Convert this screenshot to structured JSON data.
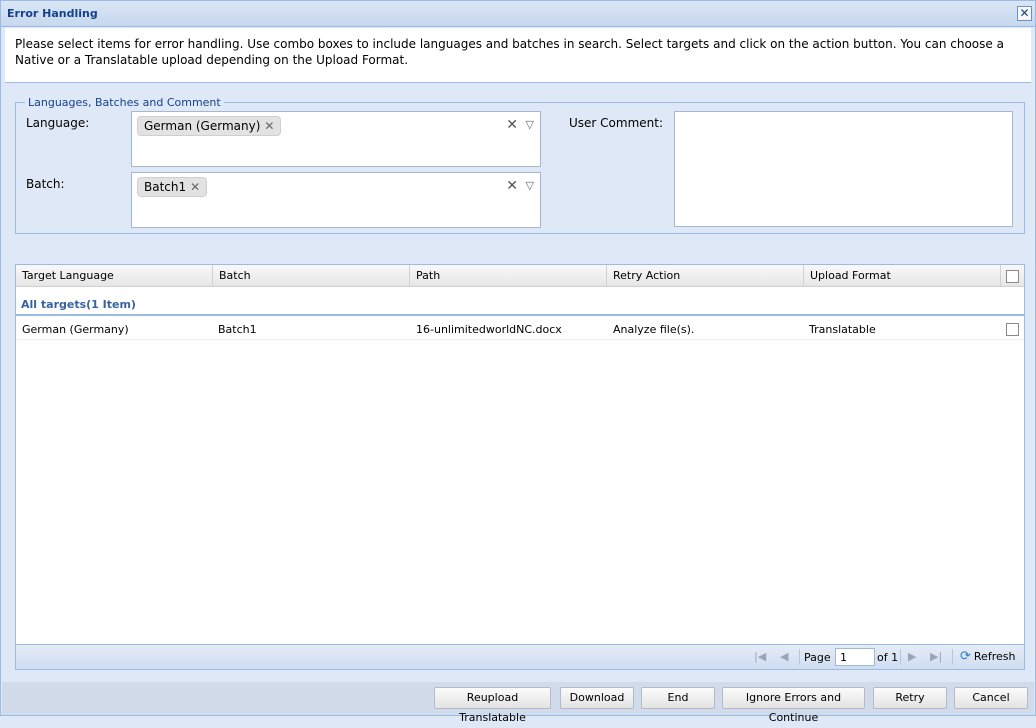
{
  "window": {
    "title": "Error Handling",
    "close_glyph": "✕"
  },
  "instructions": "Please select items for error handling. Use combo boxes to include languages and batches in search. Select targets and click on the action button. You can choose a Native or a Translatable upload depending on the Upload Format.",
  "criteria": {
    "legend": "Languages, Batches and Comment",
    "language_label": "Language:",
    "language_value": "German (Germany)",
    "batch_label": "Batch:",
    "batch_value": "Batch1",
    "comment_label": "User Comment:",
    "comment_value": ""
  },
  "grid": {
    "columns": [
      "Target Language",
      "Batch",
      "Path",
      "Retry Action",
      "Upload Format"
    ],
    "group_label": "All targets(1 Item)",
    "rows": [
      {
        "target_language": "German (Germany)",
        "batch": "Batch1",
        "path": "16-unlimitedworldNC.docx",
        "retry_action": "Analyze file(s).",
        "upload_format": "Translatable"
      }
    ]
  },
  "pager": {
    "page_label": "Page",
    "page_value": "1",
    "of_label": "of 1",
    "refresh_label": "Refresh"
  },
  "buttons": {
    "reupload": "Reupload Translatable",
    "download": "Download",
    "end": "End",
    "ignore": "Ignore Errors and Continue",
    "retry": "Retry",
    "cancel": "Cancel"
  },
  "colors": {
    "accent": "#15428b",
    "border": "#99bbe8",
    "background": "#dfe8f6"
  }
}
